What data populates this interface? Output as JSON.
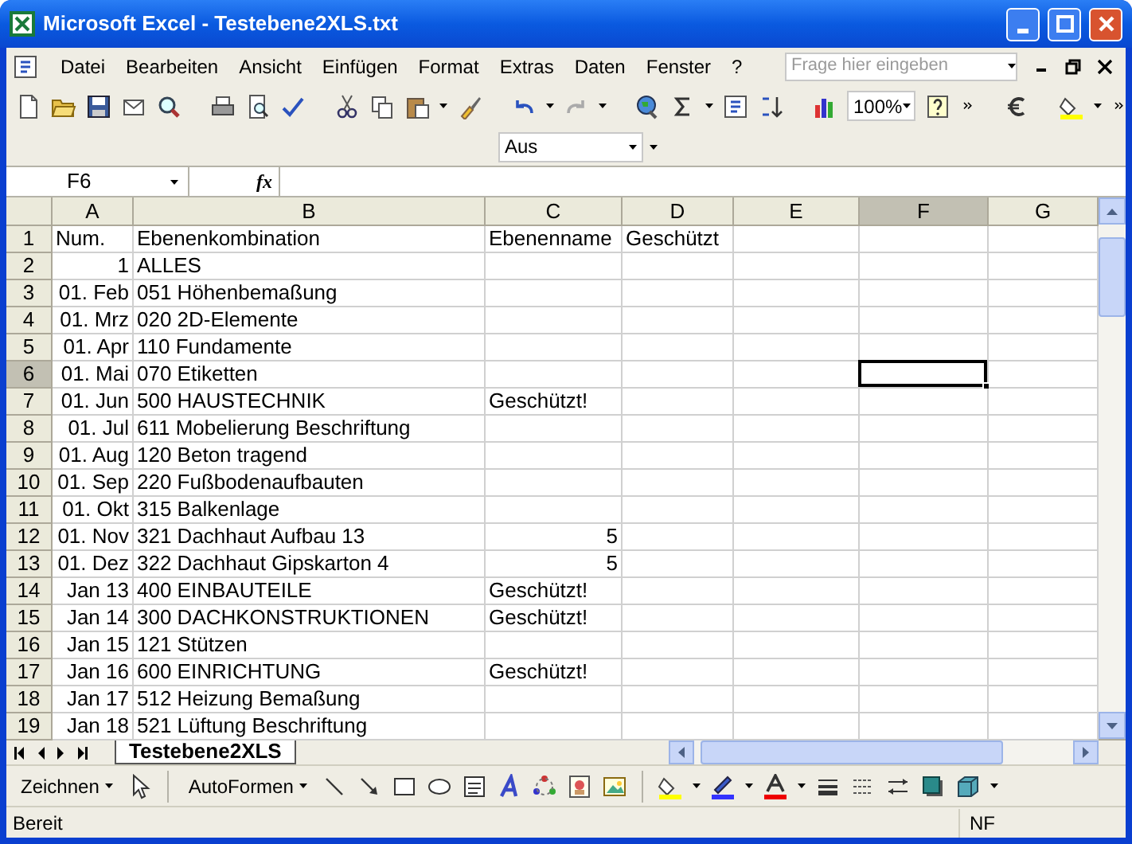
{
  "window": {
    "title": "Microsoft Excel - Testebene2XLS.txt"
  },
  "menu": [
    "Datei",
    "Bearbeiten",
    "Ansicht",
    "Einfügen",
    "Format",
    "Extras",
    "Daten",
    "Fenster",
    "?"
  ],
  "help_search": {
    "placeholder": "Frage hier eingeben"
  },
  "toolbar": {
    "zoom": "100%"
  },
  "format_toolbar": {
    "dropdown": "Aus"
  },
  "formula_bar": {
    "name_box": "F6",
    "fx": "fx"
  },
  "columns": [
    {
      "label": "A",
      "selected": false
    },
    {
      "label": "B",
      "selected": false
    },
    {
      "label": "C",
      "selected": false
    },
    {
      "label": "D",
      "selected": false
    },
    {
      "label": "E",
      "selected": false
    },
    {
      "label": "F",
      "selected": true
    },
    {
      "label": "G",
      "selected": false
    }
  ],
  "rows": [
    {
      "number": "1",
      "selected": false,
      "cells": [
        {
          "text": "Num.",
          "kind": "text"
        },
        {
          "text": "Ebenenkombination",
          "kind": "text"
        },
        {
          "text": "Ebenenname",
          "kind": "text"
        },
        {
          "text": "Geschützt",
          "kind": "text"
        }
      ]
    },
    {
      "number": "2",
      "selected": false,
      "cells": [
        {
          "text": "1",
          "kind": "number"
        },
        {
          "text": "ALLES",
          "kind": "text"
        }
      ]
    },
    {
      "number": "3",
      "selected": false,
      "cells": [
        {
          "text": "01. Feb",
          "kind": "date"
        },
        {
          "text": "051 Höhenbemaßung",
          "kind": "text"
        }
      ]
    },
    {
      "number": "4",
      "selected": false,
      "cells": [
        {
          "text": "01. Mrz",
          "kind": "date"
        },
        {
          "text": "020 2D-Elemente",
          "kind": "text"
        }
      ]
    },
    {
      "number": "5",
      "selected": false,
      "cells": [
        {
          "text": "01. Apr",
          "kind": "date"
        },
        {
          "text": "110 Fundamente",
          "kind": "text"
        }
      ]
    },
    {
      "number": "6",
      "selected": true,
      "cells": [
        {
          "text": "01. Mai",
          "kind": "date"
        },
        {
          "text": "070 Etiketten",
          "kind": "text"
        }
      ]
    },
    {
      "number": "7",
      "selected": false,
      "cells": [
        {
          "text": "01. Jun",
          "kind": "date"
        },
        {
          "text": "500 HAUSTECHNIK",
          "kind": "text"
        },
        {
          "text": "Geschützt!",
          "kind": "text"
        }
      ]
    },
    {
      "number": "8",
      "selected": false,
      "cells": [
        {
          "text": "01. Jul",
          "kind": "date"
        },
        {
          "text": "611 Mobelierung Beschriftung",
          "kind": "text"
        }
      ]
    },
    {
      "number": "9",
      "selected": false,
      "cells": [
        {
          "text": "01. Aug",
          "kind": "date"
        },
        {
          "text": "120 Beton tragend",
          "kind": "text"
        }
      ]
    },
    {
      "number": "10",
      "selected": false,
      "cells": [
        {
          "text": "01. Sep",
          "kind": "date"
        },
        {
          "text": "220 Fußbodenaufbauten",
          "kind": "text"
        }
      ]
    },
    {
      "number": "11",
      "selected": false,
      "cells": [
        {
          "text": "01. Okt",
          "kind": "date"
        },
        {
          "text": "315 Balkenlage",
          "kind": "text"
        }
      ]
    },
    {
      "number": "12",
      "selected": false,
      "cells": [
        {
          "text": "01. Nov",
          "kind": "date"
        },
        {
          "text": "321 Dachhaut Aufbau 13",
          "kind": "text"
        },
        {
          "text": "5",
          "kind": "number"
        }
      ]
    },
    {
      "number": "13",
      "selected": false,
      "cells": [
        {
          "text": "01. Dez",
          "kind": "date"
        },
        {
          "text": "322 Dachhaut Gipskarton 4",
          "kind": "text"
        },
        {
          "text": "5",
          "kind": "number"
        }
      ]
    },
    {
      "number": "14",
      "selected": false,
      "cells": [
        {
          "text": "Jan 13",
          "kind": "date"
        },
        {
          "text": "400 EINBAUTEILE",
          "kind": "text"
        },
        {
          "text": "Geschützt!",
          "kind": "text"
        }
      ]
    },
    {
      "number": "15",
      "selected": false,
      "cells": [
        {
          "text": "Jan 14",
          "kind": "date"
        },
        {
          "text": "300 DACHKONSTRUKTIONEN",
          "kind": "text"
        },
        {
          "text": "Geschützt!",
          "kind": "text"
        }
      ]
    },
    {
      "number": "16",
      "selected": false,
      "cells": [
        {
          "text": "Jan 15",
          "kind": "date"
        },
        {
          "text": "121 Stützen",
          "kind": "text"
        }
      ]
    },
    {
      "number": "17",
      "selected": false,
      "cells": [
        {
          "text": "Jan 16",
          "kind": "date"
        },
        {
          "text": "600 EINRICHTUNG",
          "kind": "text"
        },
        {
          "text": "Geschützt!",
          "kind": "text"
        }
      ]
    },
    {
      "number": "18",
      "selected": false,
      "cells": [
        {
          "text": "Jan 17",
          "kind": "date"
        },
        {
          "text": "512 Heizung Bemaßung",
          "kind": "text"
        }
      ]
    },
    {
      "number": "19",
      "selected": false,
      "cells": [
        {
          "text": "Jan 18",
          "kind": "date"
        },
        {
          "text": "521 Lüftung Beschriftung",
          "kind": "text"
        }
      ]
    }
  ],
  "sheet_tabs": [
    {
      "label": "Testebene2XLS",
      "selected": true
    }
  ],
  "drawing_toolbar": {
    "draw_menu": "Zeichnen",
    "autoshapes": "AutoFormen"
  },
  "status_bar": {
    "status": "Bereit",
    "mode": "NF"
  }
}
